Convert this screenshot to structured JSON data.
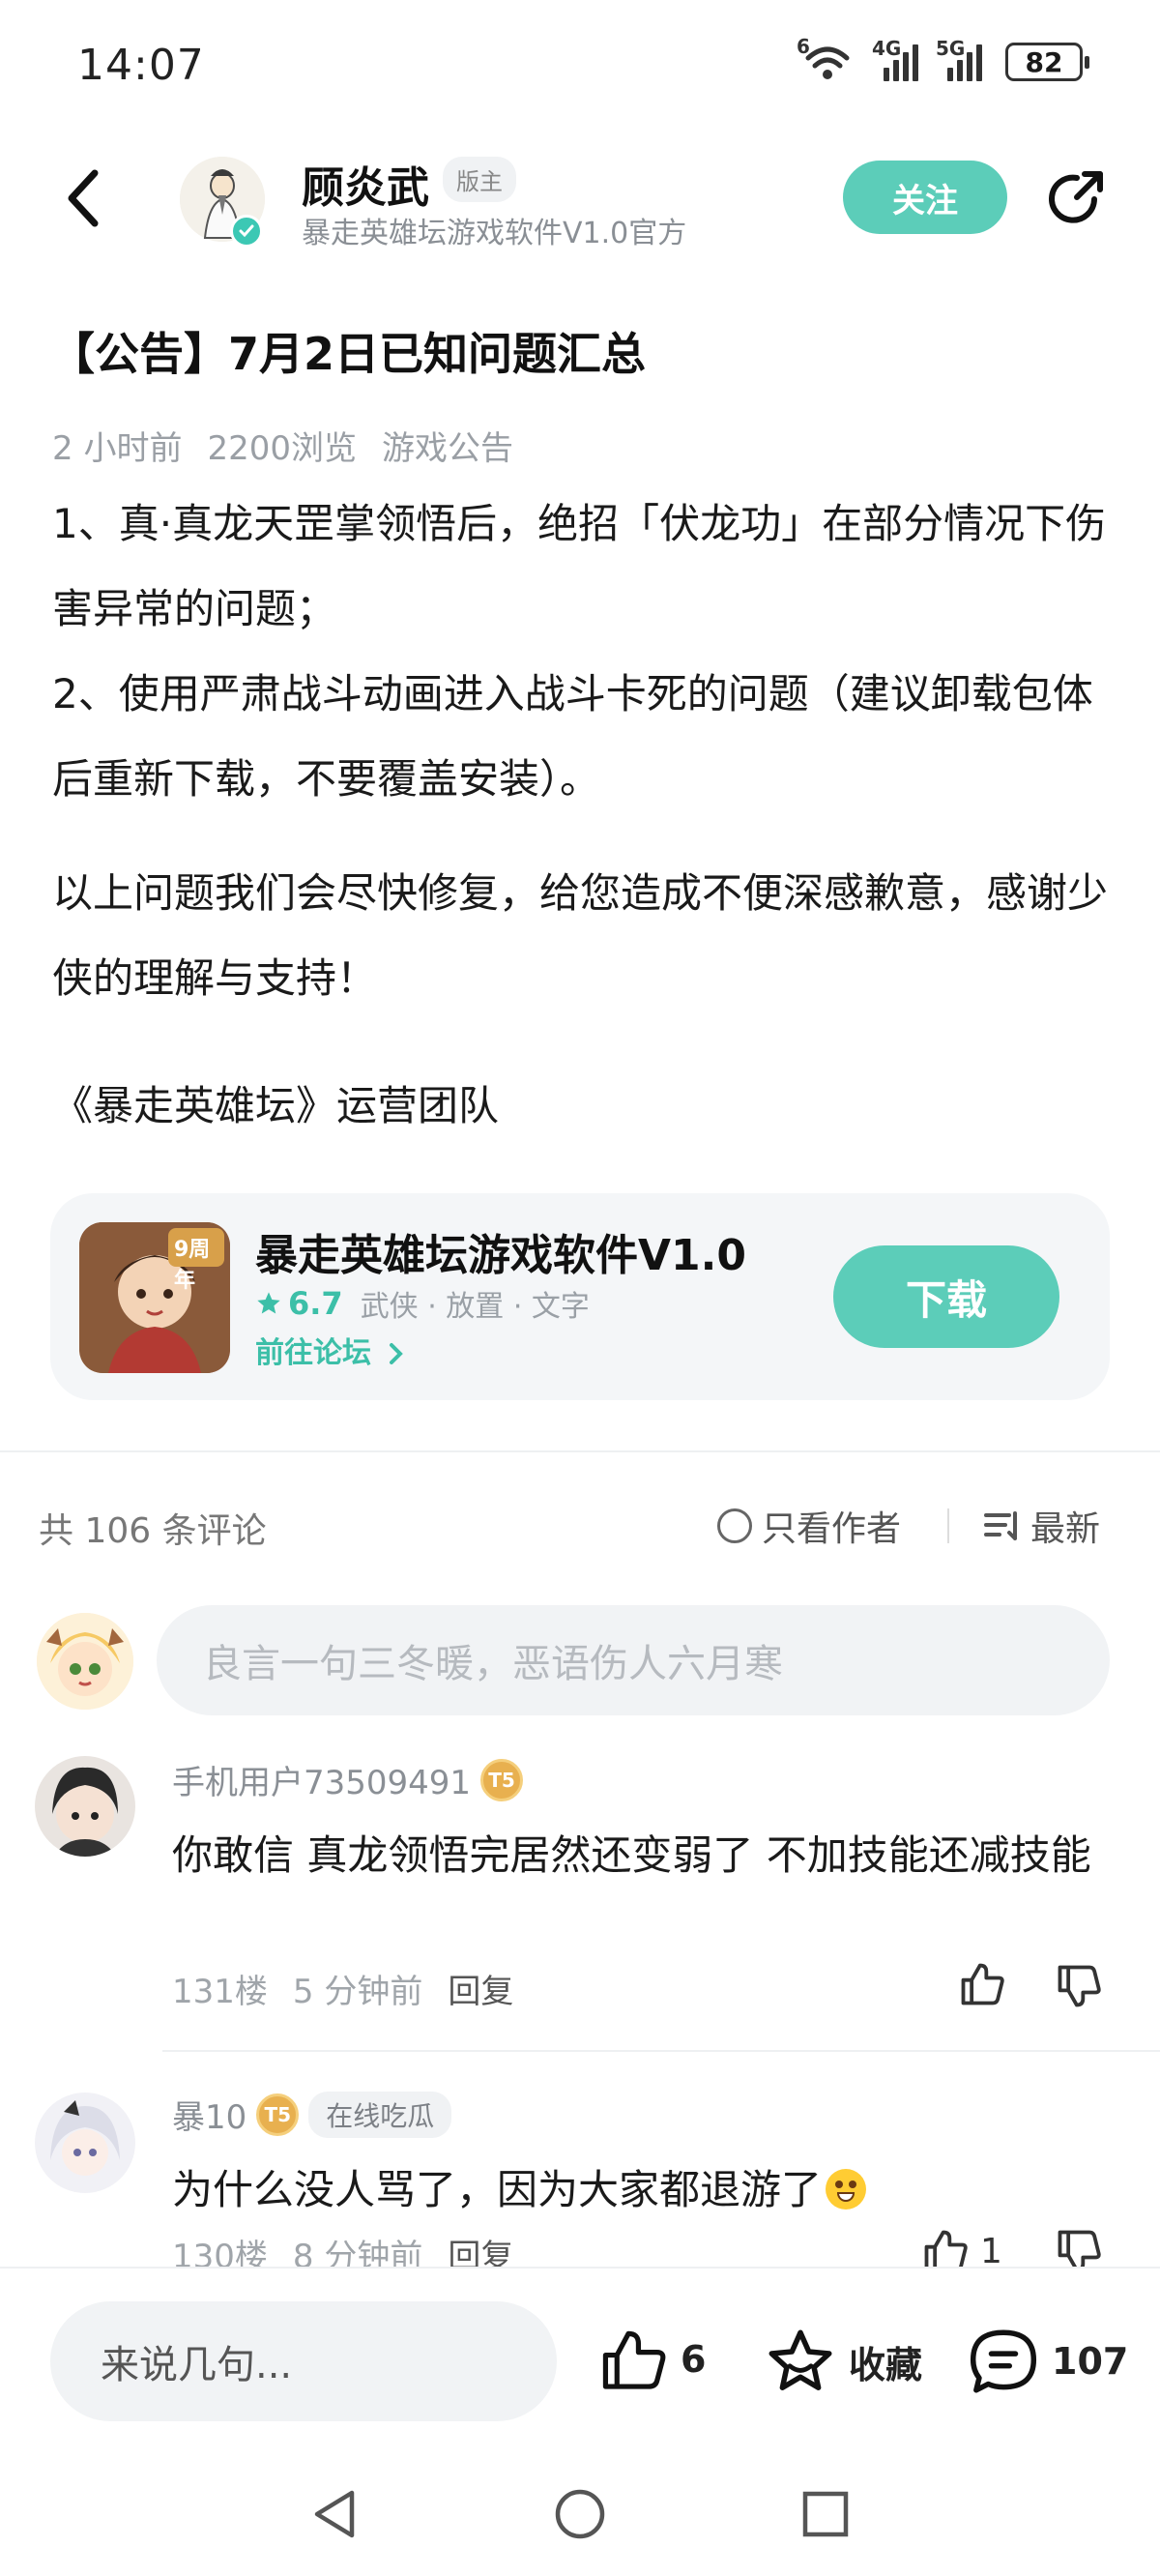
{
  "status": {
    "time": "14:07",
    "battery": "82",
    "wifi_label": "6",
    "sig1_label": "4G",
    "sig2_label": "5G"
  },
  "header": {
    "author_name": "顾炎武",
    "role": "版主",
    "subtitle": "暴走英雄坛游戏软件V1.0官方",
    "follow_label": "关注"
  },
  "post": {
    "title": "【公告】7月2日已知问题汇总",
    "meta": {
      "time": "2 小时前",
      "views": "2200浏览",
      "category": "游戏公告"
    },
    "body": [
      "1、真·真龙天罡掌领悟后，绝招「伏龙功」在部分情况下伤害异常的问题；",
      "2、使用严肃战斗动画进入战斗卡死的问题（建议卸载包体后重新下载，不要覆盖安装）。",
      "以上问题我们会尽快修复，给您造成不便深感歉意，感谢少侠的理解与支持！",
      "《暴走英雄坛》运营团队"
    ]
  },
  "game_card": {
    "icon_text": "9周年",
    "name": "暴走英雄坛游戏软件V1.0",
    "rating": "6.7",
    "tags": "武侠 · 放置 · 文字",
    "forum_link": "前往论坛",
    "download_label": "下载"
  },
  "comments_bar": {
    "count": "共 106 条评论",
    "author_only": "只看作者",
    "sort": "最新"
  },
  "comment_input": {
    "placeholder": "良言一句三冬暖，恶语伤人六月寒"
  },
  "comments": [
    {
      "user": "手机用户73509491",
      "level": "5",
      "tag": "",
      "text": "你敢信 真龙领悟完居然还变弱了 不加技能还减技能",
      "floor": "131楼",
      "time": "5 分钟前",
      "reply": "回复",
      "likes": ""
    },
    {
      "user": "暴10",
      "level": "5",
      "tag": "在线吃瓜",
      "text": "为什么没人骂了，因为大家都退游了",
      "floor": "130楼",
      "time": "8 分钟前",
      "reply": "回复",
      "likes": "1"
    }
  ],
  "bottom_bar": {
    "say_placeholder": "来说几句...",
    "like_count": "6",
    "collect_label": "收藏",
    "comment_count": "107"
  },
  "colors": {
    "accent": "#5ccdb9",
    "accent_text": "#3cbfa8"
  }
}
